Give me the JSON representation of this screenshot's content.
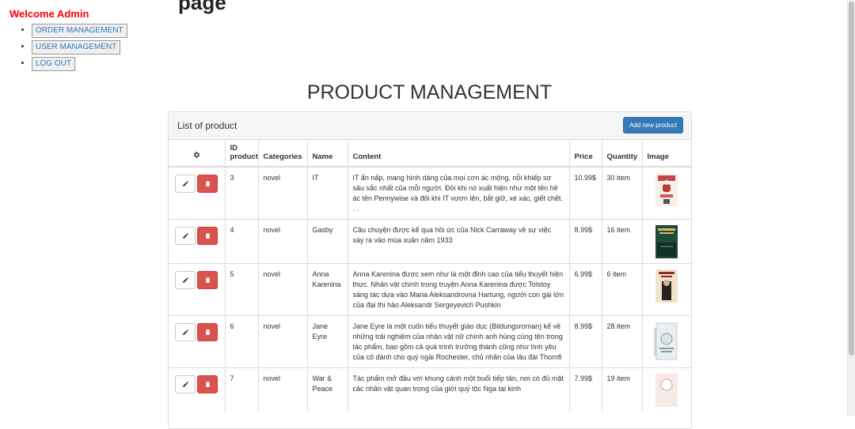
{
  "header": {
    "clipped_title": "page",
    "welcome": "Welcome Admin",
    "nav": [
      {
        "label": "ORDER MANAGEMENT"
      },
      {
        "label": "USER MANAGEMENT"
      },
      {
        "label": "LOG OUT"
      }
    ]
  },
  "main": {
    "title": "PRODUCT MANAGEMENT",
    "panel_title": "List of product",
    "add_button": "Add new product",
    "columns": {
      "id": "ID product",
      "categories": "Categories",
      "name": "Name",
      "content": "Content",
      "price": "Price",
      "quantity": "Quantity",
      "image": "Image"
    },
    "rows": [
      {
        "id": "3",
        "category": "novel",
        "name": "IT",
        "content": "IT ẩn nấp, mang hình dáng của mọi cơn ác mộng, nỗi khiếp sợ sâu sắc nhất của mỗi người. Đôi khi nó xuất hiện như một tên hề ác tên Pennywise và đôi khi IT vươn lên, bắt giữ, xé xác, giết chết. . .",
        "price": "10.99$",
        "quantity": "30 item"
      },
      {
        "id": "4",
        "category": "novel",
        "name": "Gasby",
        "content": "Câu chuyện được kể qua hồi ức của Nick Carraway về sự việc xảy ra vào mùa xuân năm 1933",
        "price": "8.99$",
        "quantity": "16 item"
      },
      {
        "id": "5",
        "category": "novel",
        "name": "Anna Karenina",
        "content": "Anna Karenina được xem như là một đỉnh cao của tiểu thuyết hiện thực. Nhân vật chính trong truyện Anna Karenina được Tolstoy sáng tác dựa vào Maria Aleksandrovna Hartung, người con gái lớn của đại thi hào Aleksandr Sergeyevich Pushkin",
        "price": "6.99$",
        "quantity": "6 item"
      },
      {
        "id": "6",
        "category": "novel",
        "name": "Jane Eyre",
        "content": "Jane Eyre là một cuốn tiểu thuyết giáo dục (Bildungsroman) kể về những trải nghiệm của nhân vật nữ chính anh hùng cùng tên trong tác phẩm, bao gồm cả quá trình trưởng thành cũng như tình yêu của cô dành cho quý ngài Rochester, chủ nhân của lâu đài Thornfi",
        "price": "8.99$",
        "quantity": "28 item"
      },
      {
        "id": "7",
        "category": "novel",
        "name": "War & Peace",
        "content": "Tác phẩm mở đầu với khung cảnh một buổi tiếp tân, nơi có đủ mặt các nhân vật quan trọng của giới quý tộc Nga tại kinh",
        "price": "7.99$",
        "quantity": "19 item"
      }
    ]
  },
  "covers": {
    "it": {
      "title": "IT",
      "author": "STEPHEN KING"
    },
    "gatsby": {
      "title": "GATSBY VI ĐẠI"
    },
    "anna": {
      "title": "ANNA KARENINA"
    },
    "jane": {
      "title": "JANE EYRE"
    }
  }
}
